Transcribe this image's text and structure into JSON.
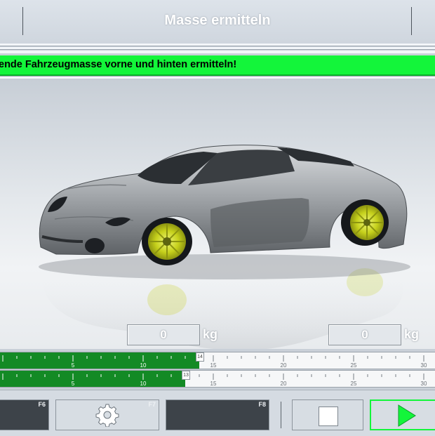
{
  "header": {
    "title": "Masse ermitteln"
  },
  "message": {
    "text": "ende Fahrzeugmasse vorne und hinten ermitteln!",
    "color": "#13f53a"
  },
  "weights": {
    "front": {
      "value": "0",
      "unit": "kg"
    },
    "rear": {
      "value": "0",
      "unit": "kg"
    }
  },
  "scales": [
    {
      "name": "front-scale",
      "value": 14,
      "ticks": [
        5,
        10,
        15,
        20,
        25,
        30
      ],
      "fill_color": "#138a25"
    },
    {
      "name": "rear-scale",
      "value": 13,
      "ticks": [
        5,
        10,
        15,
        20,
        25,
        30
      ],
      "fill_color": "#138a25"
    }
  ],
  "footer": {
    "buttons": [
      {
        "key": "F6",
        "icon": ""
      },
      {
        "key": "F7",
        "icon": "gear-icon"
      },
      {
        "key": "F8",
        "icon": ""
      },
      {
        "key": "",
        "icon": "stop-icon"
      },
      {
        "key": "",
        "icon": "play-icon",
        "accent": "#13f53a"
      }
    ]
  }
}
